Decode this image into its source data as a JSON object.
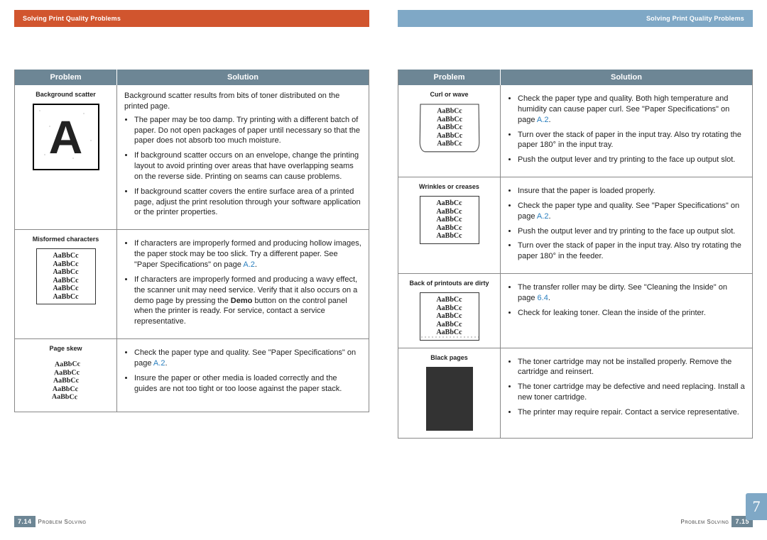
{
  "header_left": "Solving Print Quality Problems",
  "header_right": "Solving Print Quality Problems",
  "columns": {
    "problem": "Problem",
    "solution": "Solution"
  },
  "sample_text": "AaBbCc",
  "chapter_tab": "7",
  "footer": {
    "left_num": "7.14",
    "right_num": "7.15",
    "label": "Problem Solving"
  },
  "ref": {
    "A2": "A.2",
    "p64": "6.4"
  },
  "left_page": [
    {
      "name": "Background scatter",
      "sample_type": "bigA",
      "intro": "Background scatter results from bits of toner distributed on the printed page.",
      "bullets": [
        "The paper may be too damp. Try printing with a different batch of paper. Do not open packages of paper until necessary so that the paper does not absorb too much moisture.",
        "If background scatter occurs on an envelope, change the printing layout to avoid printing over areas that have overlapping seams on the reverse side. Printing on seams can cause problems.",
        "If background scatter covers the entire surface area of a printed page, adjust the print resolution through your software application or the printer properties."
      ]
    },
    {
      "name": "Misformed characters",
      "sample_type": "misformed",
      "bullets": [
        "If characters are improperly formed and producing hollow images, the paper stock may be too slick. Try a different paper. See \"Paper Specifications\" on page {A2}.",
        "If characters are improperly formed and producing a wavy effect, the scanner unit may need service. Verify that it also occurs on a demo page by pressing the {Demo} button on the control panel when the printer is ready. For service, contact a service representative."
      ]
    },
    {
      "name": "Page skew",
      "sample_type": "skew",
      "bullets": [
        "Check the paper type and quality. See \"Paper Specifications\" on page {A2}.",
        "Insure the paper or other media is loaded correctly and the guides are not too tight or too loose against the paper stack."
      ]
    }
  ],
  "right_page": [
    {
      "name": "Curl or wave",
      "sample_type": "curl",
      "bullets": [
        "Check the paper type and quality. Both high temperature and humidity can cause paper curl. See \"Paper Specifications\" on page {A2}.",
        "Turn over the stack of paper in the input tray. Also try rotating the paper 180° in the input tray.",
        "Push the output lever and try printing to the face up output slot."
      ]
    },
    {
      "name": "Wrinkles or creases",
      "sample_type": "wrinkle",
      "bullets": [
        "Insure that the paper is loaded properly.",
        "Check the paper type and quality. See \"Paper Specifications\" on page {A2}.",
        "Push the output lever and try printing to the face up output slot.",
        "Turn over the stack of paper in the input tray. Also try rotating the paper 180° in the feeder."
      ]
    },
    {
      "name": "Back of printouts are dirty",
      "sample_type": "dirty",
      "bullets": [
        "The transfer roller may be dirty. See \"Cleaning the Inside\" on page {p64}.",
        "Check for leaking toner. Clean the inside of the printer."
      ]
    },
    {
      "name": "Black pages",
      "sample_type": "blackpage",
      "bullets": [
        "The toner cartridge may not be installed properly. Remove the cartridge and reinsert.",
        "The toner cartridge may be defective and need replacing. Install a new toner cartridge.",
        "The printer may require repair. Contact a service representative."
      ]
    }
  ]
}
